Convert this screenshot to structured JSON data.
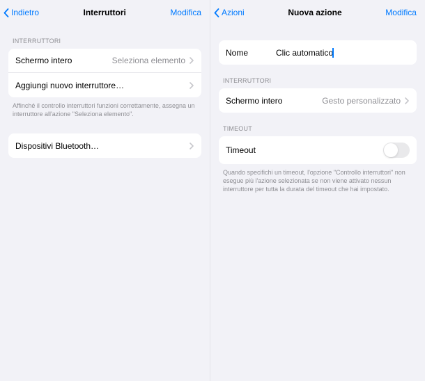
{
  "left": {
    "back": "Indietro",
    "title": "Interruttori",
    "edit": "Modifica",
    "section1_header": "INTERRUTTORI",
    "row1_label": "Schermo intero",
    "row1_value": "Seleziona elemento",
    "row2_label": "Aggiungi nuovo interruttore…",
    "footer": "Affinché il controllo interruttori funzioni correttamente, assegna un interruttore all'azione \"Seleziona elemento\".",
    "row3_label": "Dispositivi Bluetooth…"
  },
  "right": {
    "back": "Azioni",
    "title": "Nuova azione",
    "edit": "Modifica",
    "name_label": "Nome",
    "name_value": "Clic automatico",
    "section2_header": "INTERRUTTORI",
    "row1_label": "Schermo intero",
    "row1_value": "Gesto personalizzato",
    "section3_header": "TIMEOUT",
    "timeout_label": "Timeout",
    "timeout_on": false,
    "timeout_footer": "Quando specifichi un timeout, l'opzione \"Controllo interruttori\" non esegue più l'azione selezionata se non viene attivato nessun interruttore per tutta la durata del timeout che hai impostato."
  }
}
